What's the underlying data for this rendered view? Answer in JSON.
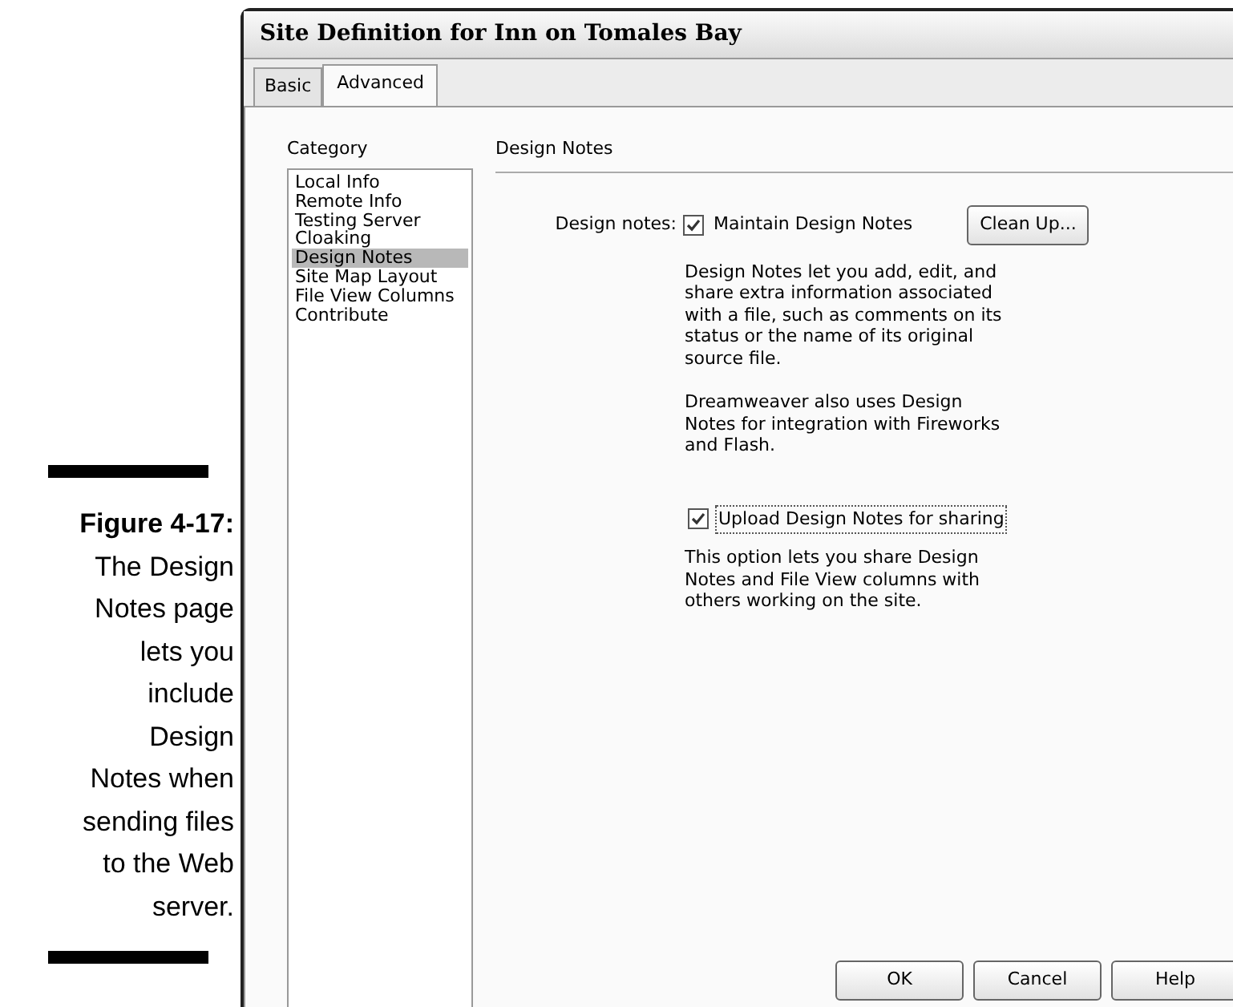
{
  "caption": {
    "text": "**Figure 4-17:** The Design Notes page lets you include Design Notes when sending files to the Web server."
  },
  "window": {
    "title": "Site Definition for Inn on Tomales Bay"
  },
  "tabs": [
    {
      "label": "Basic",
      "selected": false
    },
    {
      "label": "Advanced",
      "selected": true
    }
  ],
  "category": {
    "label": "Category",
    "items": [
      {
        "label": "Local Info",
        "selected": false
      },
      {
        "label": "Remote Info",
        "selected": false
      },
      {
        "label": "Testing Server",
        "selected": false
      },
      {
        "label": "Cloaking",
        "selected": false
      },
      {
        "label": "Design Notes",
        "selected": true
      },
      {
        "label": "Site Map Layout",
        "selected": false
      },
      {
        "label": "File View Columns",
        "selected": false
      },
      {
        "label": "Contribute",
        "selected": false
      }
    ]
  },
  "panel": {
    "heading": "Design Notes",
    "field_label": "Design notes:",
    "maintain": {
      "label": "Maintain Design Notes",
      "checked": true,
      "focused": false
    },
    "clean_up_button": "Clean Up...",
    "descriptions": [
      "Design Notes let you add, edit, and share extra information associated with a file, such as comments on its status or the name of its original source file.",
      "Dreamweaver also uses Design Notes for integration with Fireworks and Flash."
    ],
    "upload": {
      "label": "Upload Design Notes for sharing",
      "checked": true,
      "focused": true
    },
    "upload_description": "This option lets you share Design Notes and File View columns with others working on the site."
  },
  "buttons": [
    "OK",
    "Cancel",
    "Help"
  ]
}
